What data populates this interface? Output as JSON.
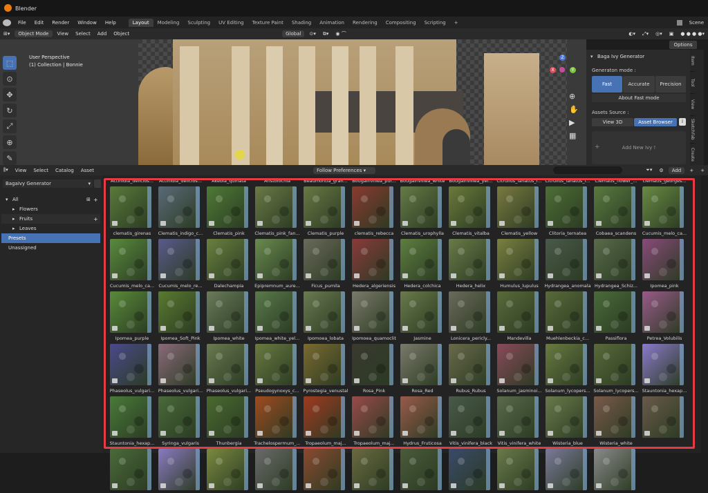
{
  "window": {
    "title": "Blender",
    "scene": "Scene"
  },
  "menu": {
    "items": [
      "File",
      "Edit",
      "Render",
      "Window",
      "Help"
    ]
  },
  "workspaces": {
    "tabs": [
      "Layout",
      "Modeling",
      "Sculpting",
      "UV Editing",
      "Texture Paint",
      "Shading",
      "Animation",
      "Rendering",
      "Compositing",
      "Scripting"
    ],
    "active": "Layout",
    "add": "+"
  },
  "viewport_header": {
    "mode": "Object Mode",
    "menus": [
      "View",
      "Select",
      "Add",
      "Object"
    ],
    "orientation": "Global",
    "options": "Options"
  },
  "viewport": {
    "perspective": "User Perspective",
    "collection": "(1) Collection | Bonnie"
  },
  "gizmo": {
    "x": "X",
    "y": "Y",
    "z": "Z"
  },
  "npanel": {
    "title": "Baga Ivy Generator",
    "generation_mode_label": "Generaton mode :",
    "modes": [
      "Fast",
      "Accurate",
      "Precision"
    ],
    "active_mode": "Fast",
    "about": "About Fast mode",
    "assets_source_label": "Assets Source :",
    "sources": [
      "View 3D",
      "Asset Browser"
    ],
    "active_source": "Asset Browser",
    "add_ivy": "Add New Ivy !",
    "tabs": [
      "Item",
      "Tool",
      "View",
      "SketchFab",
      "Create"
    ]
  },
  "asset_browser": {
    "menus": [
      "View",
      "Select",
      "Catalog",
      "Asset"
    ],
    "import_mode": "Follow Preferences",
    "add_label": "Add",
    "library": "BagaIvy Generator",
    "catalog": [
      {
        "label": "All",
        "indent": 0,
        "arrow": "▾"
      },
      {
        "label": "Flowers",
        "indent": 1,
        "arrow": "▸"
      },
      {
        "label": "Fruits",
        "indent": 1,
        "arrow": "▸"
      },
      {
        "label": "Leaves",
        "indent": 1,
        "arrow": "▸"
      },
      {
        "label": "Presets",
        "indent": 0,
        "arrow": ""
      },
      {
        "label": "Unassigned",
        "indent": 0,
        "arrow": ""
      }
    ],
    "selected_catalog": "Presets",
    "rows": [
      [
        "Actinidia_delicios...",
        "Actinidia_delicios...",
        "Akebia_quinata",
        "Aristolochia",
        "Beaumontia_gran...",
        "Bougainvillea_pur...",
        "Bougainvillea_white",
        "Bougainvillea_yel...",
        "Citrullus_lanatus_l...",
        "Citrullus_lanatus_l...",
        "Clematis_flower_...",
        "clematis_georges..."
      ],
      [
        "clematis_girenas",
        "Clematis_indigo_c...",
        "Clematis_pink",
        "Clematis_pink_fan...",
        "Clematis_purple",
        "clematis_rebecca",
        "Clematis_urophylla",
        "Clematis_vitalba",
        "Clematis_yellow",
        "Clitoria_ternatea",
        "Cobaea_scandens",
        "Cucumis_melo_ca..."
      ],
      [
        "Cucumis_melo_ca...",
        "Cucumis_melo_re...",
        "Dalechampia",
        "Epipremnum_aure...",
        "Ficus_pumila",
        "Hedera_algeriensis",
        "Hedera_colchica",
        "Hedera_helix",
        "Humulus_lupulus",
        "Hydrangea_anomala",
        "Hydrangea_Schiz...",
        "Ipomea_pink"
      ],
      [
        "Ipomea_purple",
        "Ipomea_Soft_Pink",
        "Ipomea_white",
        "Ipomea_white_yel...",
        "Ipomoea_lobata",
        "Ipomoea_quamoclit",
        "Jasmine",
        "Lonicera_pericly...",
        "Mandevilla",
        "Muehlenbeckia_c...",
        "Passiflora",
        "Petrea_Volubilis"
      ],
      [
        "Phaseolus_vulgari...",
        "Phaseolus_vulgari...",
        "Phaseolus_vulgari...",
        "Pseudogynoxys_c...",
        "Pyrostegia_venustal",
        "Rosa_Pink",
        "Rosa_Red",
        "Rubus_Rubus",
        "Solanum_jasminoi...",
        "Solanum_lycopers...",
        "Solanum_lycopers...",
        "Stauntonia_hexap..."
      ],
      [
        "Stauntonia_hexap...",
        "Syringa_vulgaris",
        "Thunbergia",
        "Trachelospermum_...",
        "Tropaeolum_maj...",
        "Tropaeolum_maj...",
        "Hydrus_Fruticosa",
        "Vitis_vinifera_black",
        "Vitis_vinifera_white",
        "Wisteria_blue",
        "Wisteria_white",
        ""
      ]
    ],
    "thumb_colors": [
      [
        "#5a7a3a",
        "#5a6a78",
        "#4f7a36",
        "#6b7a46",
        "#6a7844",
        "#8a3a30",
        "#667a46",
        "#6b7a3a",
        "#7a7a40",
        "#4e6e36",
        "#5a7a40",
        "#6a8a44"
      ],
      [
        "#5a8a3e",
        "#5a5a8a",
        "#6a8040",
        "#6a8a50",
        "#6a6a5a",
        "#8a3a3a",
        "#5e7e40",
        "#6a7a48",
        "#7a8040",
        "#4a5a4a",
        "#5a6a4a",
        "#8a4a7a"
      ],
      [
        "#5a8a3a",
        "#5a7a30",
        "#6a7a5a",
        "#5a7a4a",
        "#6a7a50",
        "#7a7a6a",
        "#6a7a4a",
        "#6a6a5a",
        "#5a6a3a",
        "#5a6a3a",
        "#4a6a3a",
        "#9a5a8a"
      ],
      [
        "#4a4a8a",
        "#8a6a7a",
        "#6a7a50",
        "#6a7a40",
        "#7a6a30",
        "#3a3a30",
        "#7a7a6a",
        "#6a6a4a",
        "#8a4a5a",
        "#6a7a40",
        "#5a6a3a",
        "#8a7aca"
      ],
      [
        "#4a7a3a",
        "#4a6a3a",
        "#4a6a30",
        "#a04a20",
        "#a03a20",
        "#9a4a4a",
        "#9a5a4a",
        "#4a5a4a",
        "#5a6a4a",
        "#6a7a4a",
        "#7a5a4a",
        "#6a5a4a"
      ],
      [
        "#4a6a3a",
        "#8a7ac0",
        "#7a8a40",
        "#6a6a6a",
        "#8a4a30",
        "#6a6a40",
        "#4a5a3a",
        "#3a4a6a",
        "#6a7a4a",
        "#7a7a9a",
        "#8a8a8a",
        ""
      ]
    ]
  }
}
